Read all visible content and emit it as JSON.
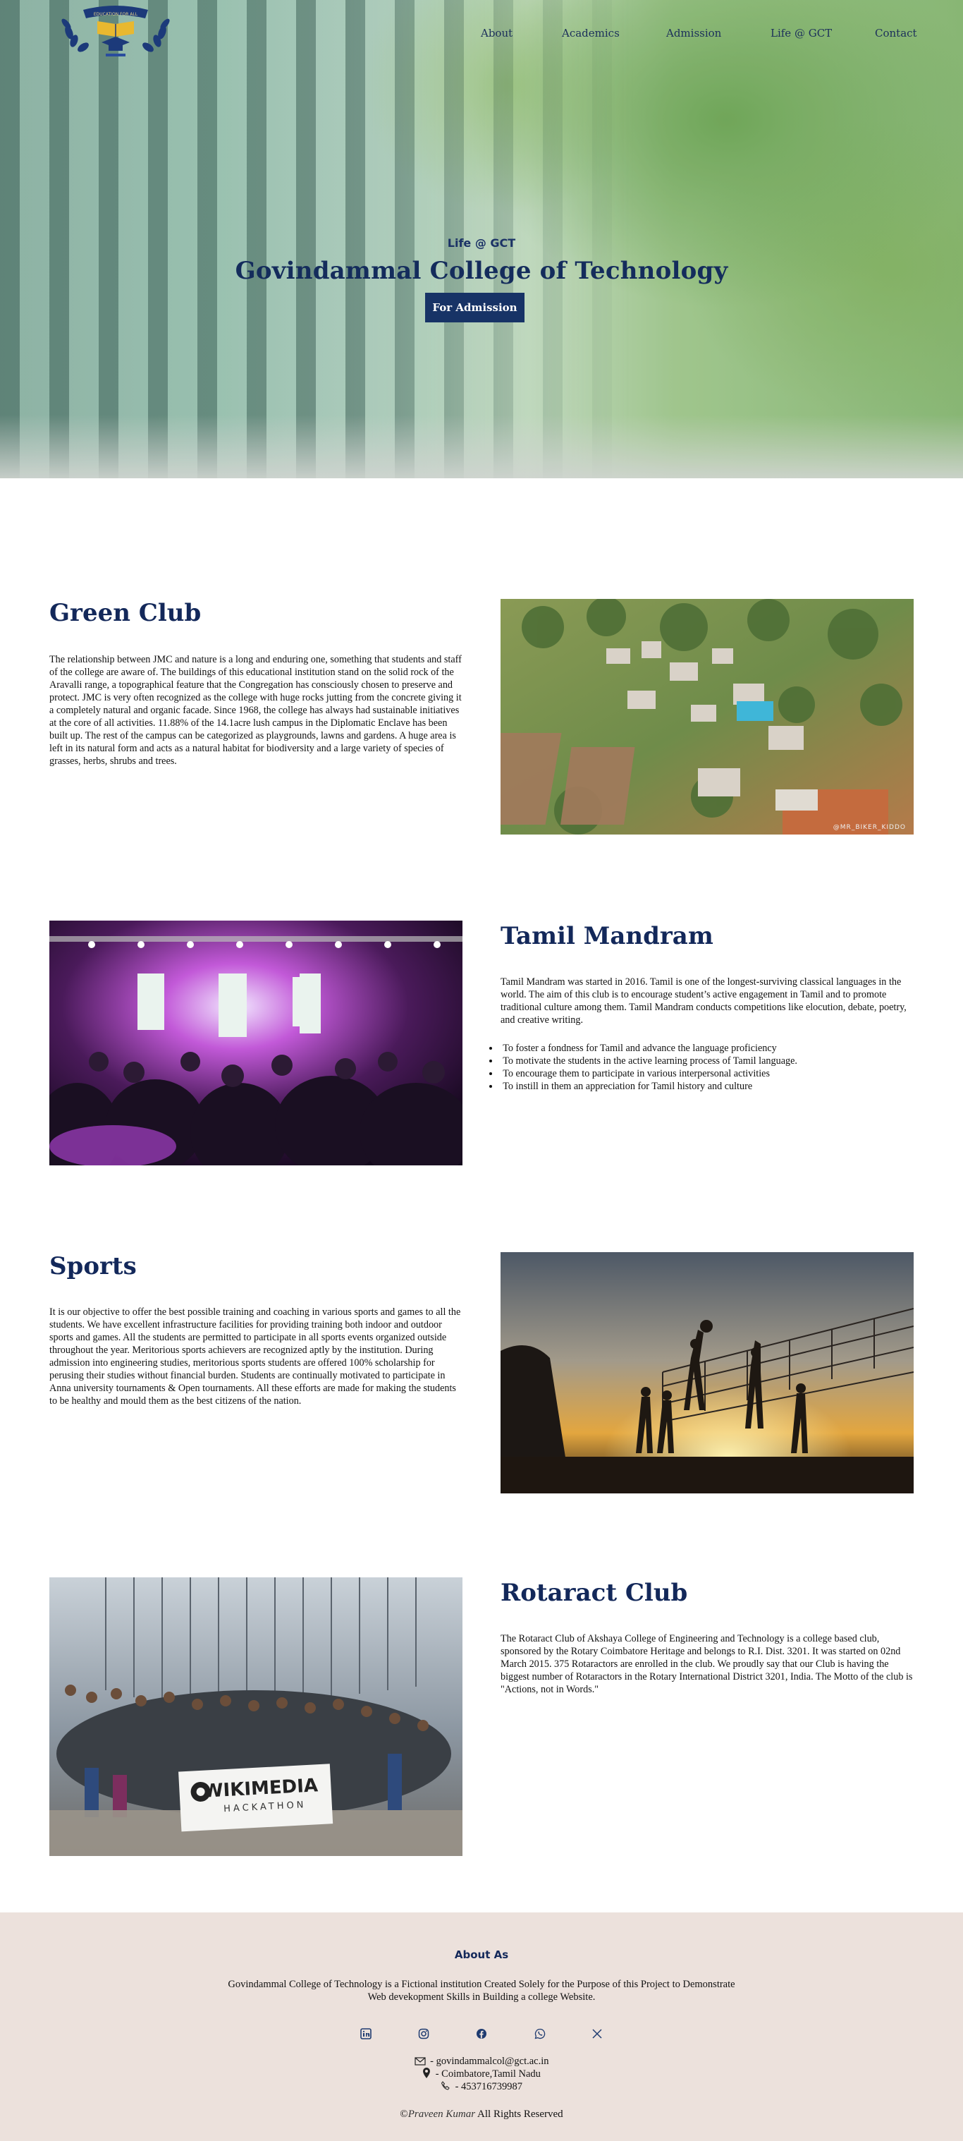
{
  "nav": {
    "items": [
      {
        "label": "About"
      },
      {
        "label": "Academics"
      },
      {
        "label": "Admission"
      },
      {
        "label": "Life @ GCT"
      },
      {
        "label": "Contact"
      }
    ]
  },
  "logo": {
    "text_top": "EDUCATION FOR ALL",
    "icon": "book-graduation-cap-laurel-logo"
  },
  "hero": {
    "kicker": "Life @ GCT",
    "title": "Govindammal College of Technology",
    "button_label": "For Admission"
  },
  "sections": [
    {
      "title": "Green Club",
      "text": "The relationship between JMC and nature is a long and enduring one, something that students and staff of the college are aware of. The buildings of this educational institution stand on the solid rock of the Aravalli range, a topographical feature that the Congregation has consciously chosen to preserve and protect. JMC is very often recognized as the college with huge rocks jutting from the concrete giving it a completely natural and organic facade. Since 1968, the college has always had sustainable initiatives at the core of all activities. 11.88% of the 14.1acre lush campus in the Diplomatic Enclave has been built up. The rest of the campus can be categorized as playgrounds, lawns and gardens. A huge area is left in its natural form and acts as a natural habitat for biodiversity and a large variety of species of grasses, herbs, shrubs and trees.",
      "photo_caption": "@MR_BIKER_KIDDO"
    },
    {
      "title": "Tamil Mandram",
      "text": "Tamil Mandram was started in 2016. Tamil is one of the longest-surviving classical languages in the world. The aim of this club is to encourage student’s active engagement in Tamil and to promote traditional culture among them. Tamil Mandram conducts competitions like elocution, debate, poetry, and creative writing.",
      "bullets": [
        "To foster a fondness for Tamil and advance the language proficiency",
        "To motivate the students in the active learning process of Tamil language.",
        "To encourage them to participate in various interpersonal activities",
        "To instill in them an appreciation for Tamil history and culture"
      ]
    },
    {
      "title": "Sports",
      "text": "It is our objective to offer the best possible training and coaching in various sports and games to all the students. We have excellent infrastructure facilities for providing training both indoor and outdoor sports and games. All the students are permitted to participate in all sports events organized outside throughout the year. Meritorious sports achievers are recognized aptly by the institution. During admission into engineering studies, meritorious sports students are offered 100% scholarship for perusing their studies without financial burden. Students are continually motivated to participate in Anna university tournaments & Open tournaments. All these efforts are made for making the students to be healthy and mould them as the best citizens of the nation."
    },
    {
      "title": "Rotaract Club",
      "text": "The Rotaract Club of Akshaya College of Engineering and Technology is a college based club, sponsored by the Rotary Coimbatore Heritage and belongs to R.I. Dist. 3201. It was started on 02nd March 2015. 375 Rotaractors are enrolled in the club. We proudly say that our Club is having the biggest number of Rotaractors in the Rotary International District 3201, India. The Motto of the club is \"Actions, not in Words.\"",
      "banner_main": "WIKIMEDIA",
      "banner_sub": "HACKATHON"
    }
  ],
  "footer": {
    "title": "About As",
    "description": "Govindammal College of Technology is a Fictional institution Created Solely for the Purpose of this Project to Demonstrate Web devekopment Skills in Building a college Website.",
    "socials": [
      "linkedin-icon",
      "instagram-icon",
      "facebook-icon",
      "whatsapp-icon",
      "x-twitter-icon"
    ],
    "email": " - govindammalcol@gct.ac.in",
    "location": " - Coimbatore,Tamil Nadu",
    "phone": " - 453716739987",
    "copyright_symbol": "©",
    "author": "Praveen Kumar",
    "rights": " All Rights Reserved"
  },
  "colors": {
    "navy": "#13285a",
    "button": "#173366",
    "footer_bg": "#ece1dc"
  }
}
